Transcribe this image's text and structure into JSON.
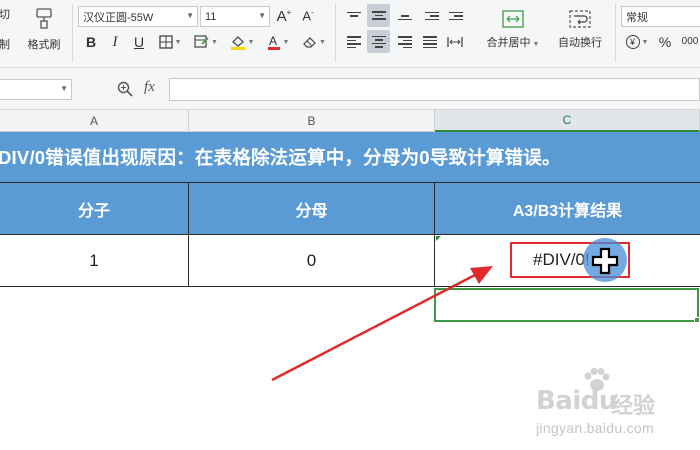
{
  "ribbon": {
    "clipboard": {
      "cut_label": "剪切",
      "copy_label": "复制",
      "format_painter_label": "格式刷"
    },
    "font": {
      "name": "汉仪正圆-55W",
      "size": "11"
    },
    "alignment": {
      "merge_center_label": "合并居中",
      "wrap_text_label": "自动换行"
    },
    "number": {
      "format": "常规"
    }
  },
  "formula_bar": {
    "fx_label": "fx",
    "value": ""
  },
  "columns": [
    "A",
    "B",
    "C"
  ],
  "sheet": {
    "banner": "DIV/0错误值出现原因：在表格除法运算中，分母为0导致计算错误。",
    "headers": [
      "分子",
      "分母",
      "A3/B3计算结果"
    ],
    "row": [
      "1",
      "0",
      "#DIV/0!"
    ]
  },
  "watermark": {
    "brand": "Baidu",
    "brand_cn": "经验",
    "url": "jingyan.baidu.com"
  },
  "colors": {
    "header_fill": "#5b9bd5",
    "selection": "#3d9a44",
    "highlight": "#e22a2a"
  }
}
